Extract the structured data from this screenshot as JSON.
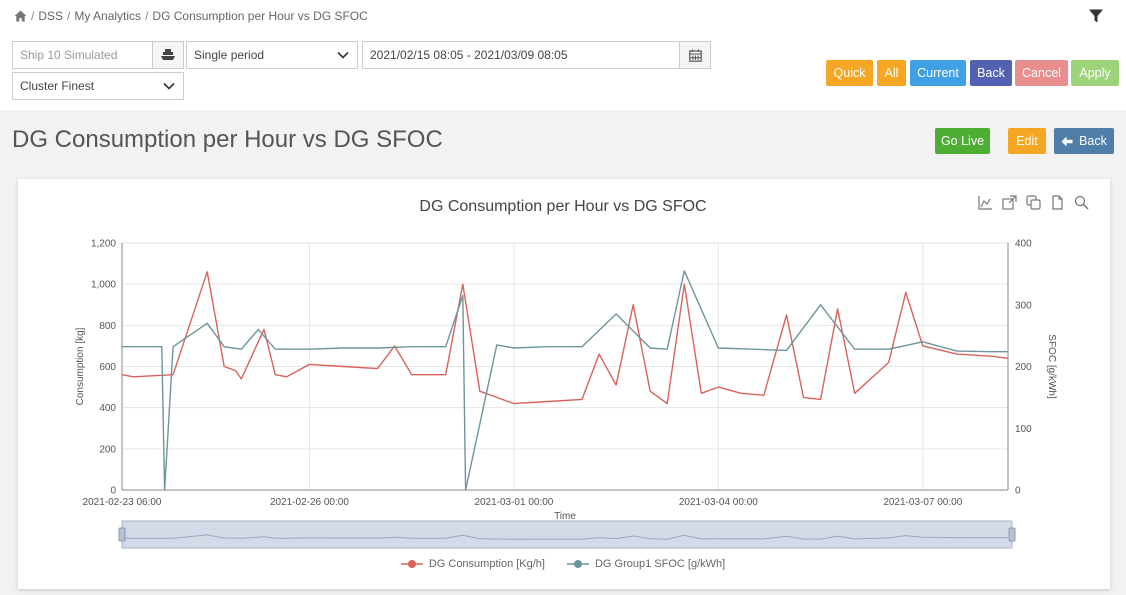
{
  "breadcrumb": {
    "items": [
      "DSS",
      "My Analytics",
      "DG Consumption per Hour vs DG SFOC"
    ]
  },
  "filters": {
    "ship_placeholder": "Ship 10 Simulated",
    "period": "Single period",
    "date_range": "2021/02/15 08:05 - 2021/03/09 08:05",
    "cluster": "Cluster Finest"
  },
  "actions": {
    "quick": "Quick",
    "all": "All",
    "current": "Current",
    "back": "Back",
    "cancel": "Cancel",
    "apply": "Apply"
  },
  "page": {
    "title": "DG Consumption per Hour vs DG SFOC",
    "go_live": "Go Live",
    "edit": "Edit",
    "back": "Back"
  },
  "colors": {
    "consumption": "#d9625b",
    "sfoc": "#6e959c",
    "grid": "#e6e6e6"
  },
  "chart_data": {
    "type": "line",
    "title": "DG Consumption per Hour vs DG SFOC",
    "xlabel": "Time",
    "ylabel_left": "Consumption [kg]",
    "ylabel_right": "SFOC [g/kWh]",
    "ylim_left": [
      0,
      1200
    ],
    "ylim_right": [
      0,
      400
    ],
    "y_ticks_left": [
      "0",
      "200",
      "400",
      "600",
      "800",
      "1,000",
      "1,200"
    ],
    "y_ticks_right": [
      "0",
      "100",
      "200",
      "300",
      "400"
    ],
    "x_range": [
      "2021-02-23 06:00",
      "2021-03-08 06:00"
    ],
    "x_ticks": [
      "2021-02-23 06:00",
      "2021-02-26 00:00",
      "2021-03-01 00:00",
      "2021-03-04 00:00",
      "2021-03-07 00:00"
    ],
    "grid": true,
    "legend_position": "bottom-center",
    "series": [
      {
        "name": "DG Consumption [Kg/h]",
        "axis": "left",
        "x": [
          "2021-02-23 06:00",
          "2021-02-23 10:00",
          "2021-02-24 00:00",
          "2021-02-24 12:00",
          "2021-02-24 18:00",
          "2021-02-24 22:00",
          "2021-02-25 00:00",
          "2021-02-25 08:00",
          "2021-02-25 12:00",
          "2021-02-25 16:00",
          "2021-02-26 00:00",
          "2021-02-26 12:00",
          "2021-02-27 00:00",
          "2021-02-27 06:00",
          "2021-02-27 12:00",
          "2021-02-28 00:00",
          "2021-02-28 06:00",
          "2021-02-28 12:00",
          "2021-02-28 18:00",
          "2021-03-01 00:00",
          "2021-03-01 12:00",
          "2021-03-02 00:00",
          "2021-03-02 06:00",
          "2021-03-02 12:00",
          "2021-03-02 18:00",
          "2021-03-03 00:00",
          "2021-03-03 06:00",
          "2021-03-03 12:00",
          "2021-03-03 18:00",
          "2021-03-04 00:00",
          "2021-03-04 08:00",
          "2021-03-04 16:00",
          "2021-03-05 00:00",
          "2021-03-05 06:00",
          "2021-03-05 12:00",
          "2021-03-05 18:00",
          "2021-03-06 00:00",
          "2021-03-06 12:00",
          "2021-03-06 18:00",
          "2021-03-07 00:00",
          "2021-03-07 12:00",
          "2021-03-08 00:00",
          "2021-03-08 06:00"
        ],
        "values": [
          560,
          550,
          560,
          1060,
          600,
          580,
          540,
          780,
          560,
          550,
          610,
          600,
          590,
          700,
          560,
          560,
          1000,
          480,
          450,
          420,
          430,
          440,
          660,
          510,
          900,
          480,
          420,
          1000,
          470,
          500,
          470,
          460,
          850,
          450,
          440,
          880,
          470,
          620,
          960,
          700,
          660,
          650,
          640
        ]
      },
      {
        "name": "DG Group1 SFOC [g/kWh]",
        "axis": "right",
        "x": [
          "2021-02-23 06:00",
          "2021-02-23 20:00",
          "2021-02-23 21:00",
          "2021-02-24 00:00",
          "2021-02-24 12:00",
          "2021-02-24 18:00",
          "2021-02-25 00:00",
          "2021-02-25 06:00",
          "2021-02-25 12:00",
          "2021-02-26 00:00",
          "2021-02-26 12:00",
          "2021-02-27 00:00",
          "2021-02-27 12:00",
          "2021-02-28 00:00",
          "2021-02-28 06:00",
          "2021-02-28 07:00",
          "2021-02-28 18:00",
          "2021-03-01 00:00",
          "2021-03-01 12:00",
          "2021-03-02 00:00",
          "2021-03-02 12:00",
          "2021-03-03 00:00",
          "2021-03-03 06:00",
          "2021-03-03 12:00",
          "2021-03-04 00:00",
          "2021-03-04 12:00",
          "2021-03-05 00:00",
          "2021-03-05 12:00",
          "2021-03-06 00:00",
          "2021-03-06 12:00",
          "2021-03-07 00:00",
          "2021-03-07 12:00",
          "2021-03-08 00:00",
          "2021-03-08 06:00"
        ],
        "values": [
          232,
          232,
          0,
          232,
          270,
          232,
          228,
          260,
          228,
          228,
          230,
          230,
          232,
          232,
          315,
          0,
          235,
          230,
          232,
          232,
          285,
          230,
          228,
          355,
          230,
          228,
          226,
          300,
          228,
          228,
          240,
          225,
          224,
          224
        ]
      }
    ]
  }
}
